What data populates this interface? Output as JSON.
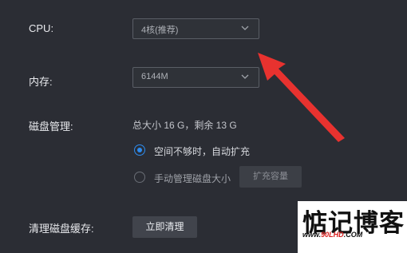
{
  "settings": {
    "cpu": {
      "label": "CPU:",
      "value": "4核(推荐)"
    },
    "memory": {
      "label": "内存:",
      "value": "6144M"
    },
    "disk": {
      "label": "磁盘管理:",
      "summary": "总大小 16 G，剩余 13 G",
      "options": [
        {
          "label": "空间不够时，自动扩充",
          "selected": true
        },
        {
          "label": "手动管理磁盘大小",
          "selected": false
        }
      ],
      "expand_button": "扩充容量"
    },
    "cache": {
      "label": "清理磁盘缓存:",
      "clear_button": "立即清理"
    }
  },
  "colors": {
    "background": "#2b2d34",
    "accent": "#2d8cf0",
    "annotation_arrow": "#e8322f"
  },
  "icons": {
    "dropdown": "chevron-down-icon",
    "annotation": "red-arrow-icon"
  },
  "watermark": {
    "title": "惦记博客",
    "url_prefix": "www.",
    "url_main": "90LHD",
    "url_suffix": ".COM"
  }
}
